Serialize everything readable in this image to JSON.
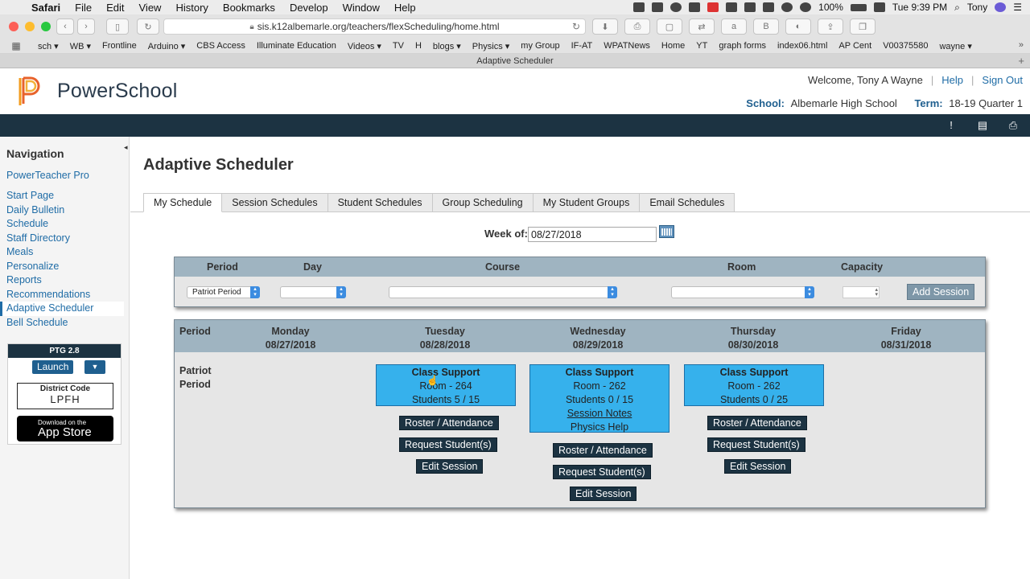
{
  "os_menu": {
    "items": [
      "Safari",
      "File",
      "Edit",
      "View",
      "History",
      "Bookmarks",
      "Develop",
      "Window",
      "Help"
    ],
    "battery": "100%",
    "time": "Tue 9:39 PM",
    "user": "Tony"
  },
  "browser": {
    "url": "sis.k12albemarle.org/teachers/flexScheduling/home.html",
    "tab_title": "Adaptive Scheduler",
    "bookmarks": [
      "sch ▾",
      "WB ▾",
      "Frontline",
      "Arduino ▾",
      "CBS Access",
      "Illuminate Education",
      "Videos ▾",
      "TV",
      "H",
      "blogs ▾",
      "Physics ▾",
      "my Group",
      "IF-AT",
      "WPATNews",
      "Home",
      "YT",
      "graph forms",
      "index06.html",
      "AP Cent",
      "V00375580",
      "wayne ▾"
    ]
  },
  "header": {
    "logo_text": "PowerSchool",
    "welcome": "Welcome, Tony A Wayne",
    "help": "Help",
    "sign_out": "Sign Out",
    "school_label": "School:",
    "school": "Albemarle High School",
    "term_label": "Term:",
    "term": "18-19 Quarter 1"
  },
  "sidebar": {
    "heading": "Navigation",
    "pro_link": "PowerTeacher Pro",
    "items": [
      "Start Page",
      "Daily Bulletin",
      "Schedule",
      "Staff Directory",
      "Meals",
      "Personalize",
      "Reports",
      "Recommendations",
      "Adaptive Scheduler",
      "Bell Schedule"
    ],
    "ptg": {
      "title": "PTG 2.8",
      "launch": "Launch",
      "district_label": "District Code",
      "district_code": "LPFH",
      "appstore_line1": "Download on the",
      "appstore_line2": "App Store"
    }
  },
  "main": {
    "title": "Adaptive Scheduler",
    "tabs": [
      "My Schedule",
      "Session Schedules",
      "Student Schedules",
      "Group Scheduling",
      "My Student Groups",
      "Email Schedules"
    ],
    "week_label": "Week of:",
    "week_value": "08/27/2018"
  },
  "add_panel": {
    "headers": {
      "period": "Period",
      "day": "Day",
      "course": "Course",
      "room": "Room",
      "capacity": "Capacity"
    },
    "period_value": "Patriot Period",
    "add_button": "Add Session"
  },
  "schedule": {
    "period_header": "Period",
    "days": [
      {
        "name": "Monday",
        "date": "08/27/2018"
      },
      {
        "name": "Tuesday",
        "date": "08/28/2018"
      },
      {
        "name": "Wednesday",
        "date": "08/29/2018"
      },
      {
        "name": "Thursday",
        "date": "08/30/2018"
      },
      {
        "name": "Friday",
        "date": "08/31/2018"
      }
    ],
    "period_name": "Patriot Period",
    "sessions": [
      {
        "title": "Class Support",
        "room": "Room - 264",
        "students": "Students 5 / 15"
      },
      {
        "title": "Class Support",
        "room": "Room - 262",
        "students": "Students 0 / 15",
        "notes": "Session Notes",
        "extra": "Physics Help"
      },
      {
        "title": "Class Support",
        "room": "Room - 262",
        "students": "Students 0 / 25"
      }
    ],
    "buttons": {
      "roster": "Roster / Attendance",
      "request": "Request Student(s)",
      "edit": "Edit Session"
    }
  },
  "colors": {
    "nav_dark": "#1c3342",
    "card_blue": "#36b1ec",
    "header_blue": "#9fb4c1",
    "link_blue": "#1f6ca6"
  }
}
